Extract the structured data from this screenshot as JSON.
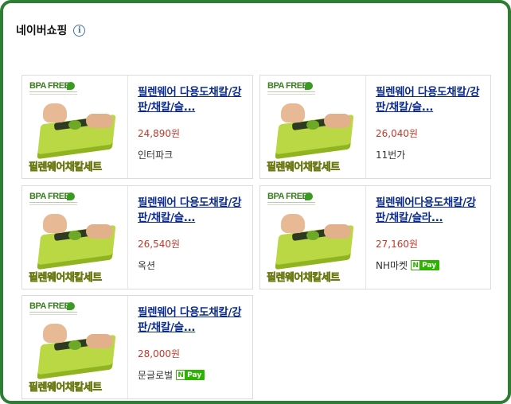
{
  "header": {
    "title": "네이버쇼핑",
    "info_icon": "info-icon",
    "info_glyph": "i"
  },
  "image": {
    "badge": "BPA FREE",
    "caption": "필렌웨어채칼세트"
  },
  "products": [
    {
      "title": "필렌웨어 다용도채칼/강판/채칼/슬...",
      "price": "24,890원",
      "seller": "인터파크",
      "npay": false
    },
    {
      "title": "필렌웨어 다용도채칼/강판/채칼/슬...",
      "price": "26,040원",
      "seller": "11번가",
      "npay": false
    },
    {
      "title": "필렌웨어 다용도채칼/강판/채칼/슬...",
      "price": "26,540원",
      "seller": "옥션",
      "npay": false
    },
    {
      "title": "필렌웨어다용도채칼/강판/채칼/슬라...",
      "price": "27,160원",
      "seller": "NH마켓",
      "npay": true
    },
    {
      "title": "필렌웨어 다용도채칼/강판/채칼/슬...",
      "price": "28,000원",
      "seller": "문글로벌",
      "npay": true
    }
  ],
  "npay_badge": {
    "n": "N",
    "label": "Pay"
  },
  "colors": {
    "frame": "#2e7d32",
    "link": "#0a2b8c",
    "price": "#c0392b",
    "npay": "#2db400"
  }
}
